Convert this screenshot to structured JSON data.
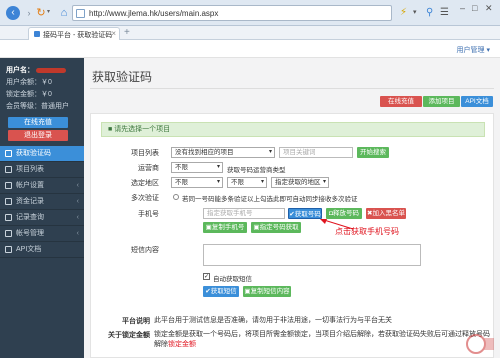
{
  "browser": {
    "url": "http://www.jlema.hk/users/main.aspx",
    "tab_title": "接码平台 - 获取验证码",
    "new_tab": "+"
  },
  "header": {
    "user_menu": "用户管理 ▾"
  },
  "sidebar": {
    "username_label": "用户名：",
    "points": "用户余额：￥0",
    "locked": "锁定金额：￥0",
    "level": "会员等级：普通用户",
    "online_btn": "在线充值",
    "logout_btn": "退出登录",
    "items": [
      {
        "label": "获取验证码",
        "active": true
      },
      {
        "label": "项目列表",
        "active": false
      },
      {
        "label": "帐户设置",
        "active": false
      },
      {
        "label": "资金记录",
        "active": false
      },
      {
        "label": "记录查询",
        "active": false
      },
      {
        "label": "帐号管理",
        "active": false
      },
      {
        "label": "API文档",
        "active": false
      }
    ]
  },
  "main": {
    "title": "获取验证码",
    "actions": {
      "online": "在线充值",
      "add": "添加项目",
      "api": "API文档"
    },
    "notice": "请先选择一个项目",
    "form": {
      "project_label": "项目列表",
      "project_value": "没有找到相应的项目",
      "project_search_placeholder": "项目关键词",
      "start_search": "开始搜索",
      "carrier_label": "运营商",
      "carrier_value": "不限",
      "carrier_hint": "获取号码运营商类型",
      "area_label": "选定地区",
      "area_province": "不限",
      "area_city": "不限",
      "area_hint": "指定获取的地区",
      "multi_label": "多次验证",
      "multi_text": "若同一号码能多条验证以上勾选此即可自动同步接收多次验证",
      "phone_label": "手机号",
      "phone_placeholder": "指定获取手机号",
      "get_number": "获取号码",
      "release_number": "释放号码",
      "blacklist": "加入黑名单",
      "copy_phone": "复制手机号",
      "specify_phone": "指定号码获取",
      "sms_label": "短信内容",
      "auto_fetch": "自动获取短信",
      "get_sms": "获取短信",
      "copy_sms": "复制短信内容"
    },
    "annotation": "点击获取手机号码"
  },
  "info": {
    "platform_label": "平台说明",
    "platform_text": "此平台用于测试信息是否准确，请勿用于非法用途，一切事法行为与平台无关",
    "fee_label": "关于锁定金额",
    "fee_text": "锁定金额是获取一个号码后，将项目所需金额锁定，当项目介绍后解除，若获取验证码失败后可通过释放号码解除",
    "fee_hl": "锁定金额"
  },
  "colors": {
    "sidebar": "#2f4050",
    "primary": "#3b8fd9",
    "danger": "#d9534f",
    "success": "#5cb85c",
    "annotation": "#e0131e"
  }
}
